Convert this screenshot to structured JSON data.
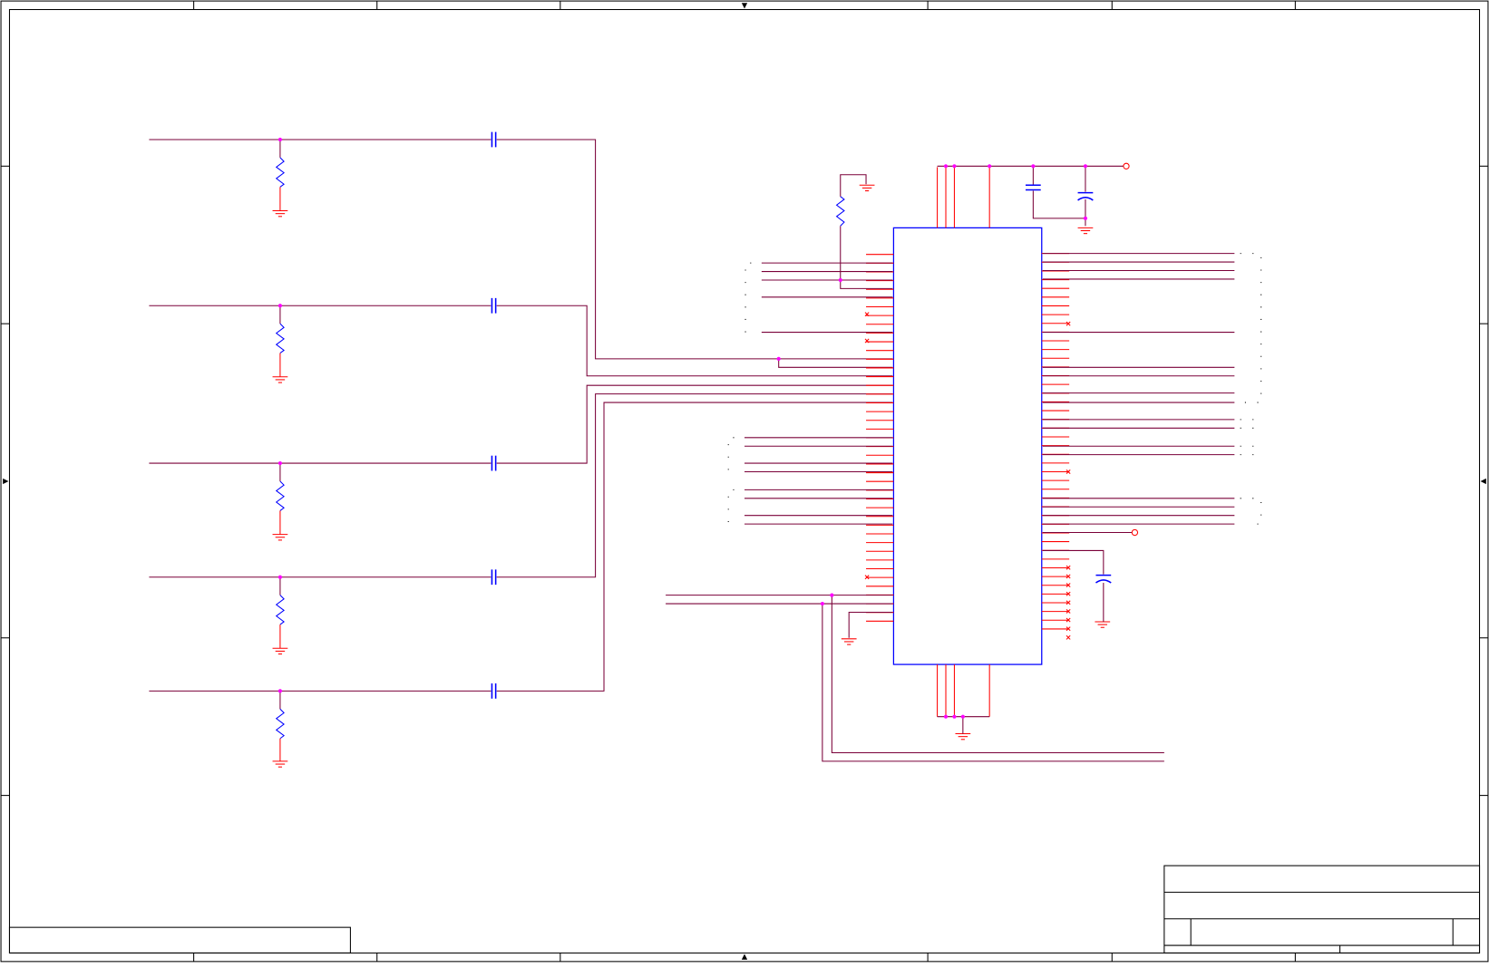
{
  "schematic": {
    "frame": {
      "zone_columns": [
        "",
        "",
        "",
        "",
        "",
        "",
        "",
        ""
      ],
      "zone_rows": [
        "",
        "",
        "",
        "",
        "",
        ""
      ]
    },
    "title_block": {
      "title": "",
      "subtitle": "",
      "size": "",
      "number": "",
      "revision": "",
      "date": "",
      "sheet": ""
    },
    "notes_box": {
      "text": ""
    },
    "colors": {
      "border": "#000000",
      "wire": "#7a0038",
      "pin": "#ff0000",
      "component": "#0000ff",
      "junction": "#ff00ff",
      "ground": "#ff0000"
    },
    "input_channels": 5,
    "ic": {
      "left_pins": 43,
      "right_pins": 44
    }
  }
}
